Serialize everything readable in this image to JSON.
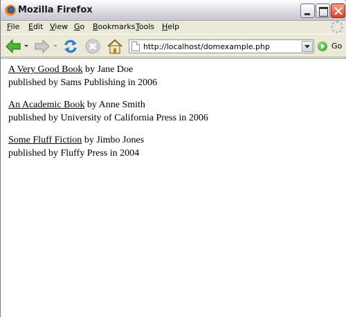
{
  "window": {
    "title": "Mozilla Firefox"
  },
  "menu": [
    {
      "key": "F",
      "rest": "ile"
    },
    {
      "key": "E",
      "rest": "dit"
    },
    {
      "key": "V",
      "rest": "iew"
    },
    {
      "key": "G",
      "rest": "o"
    },
    {
      "key": "B",
      "rest": "ookmarks"
    },
    {
      "key": "T",
      "rest": "ools"
    },
    {
      "key": "H",
      "rest": "elp"
    }
  ],
  "toolbar": {
    "url": "http://localhost/domexample.php",
    "go_label": "Go"
  },
  "icons": {
    "back": "back-arrow-icon",
    "forward": "forward-arrow-icon",
    "reload": "reload-icon",
    "stop": "stop-icon",
    "home": "home-icon",
    "page": "page-icon",
    "go": "go-icon"
  },
  "books": [
    {
      "title": "A Very Good Book",
      "by": " by Jane Doe",
      "published": "published by Sams Publishing in 2006"
    },
    {
      "title": "An Academic Book",
      "by": " by Anne Smith",
      "published": "published by University of California Press in 2006"
    },
    {
      "title": "Some Fluff Fiction",
      "by": " by Jimbo Jones",
      "published": "published by Fluffy Press in 2004"
    }
  ],
  "colors": {
    "chrome": "#ece9d8",
    "content_bg": "#ffffff",
    "link": "#000000"
  }
}
